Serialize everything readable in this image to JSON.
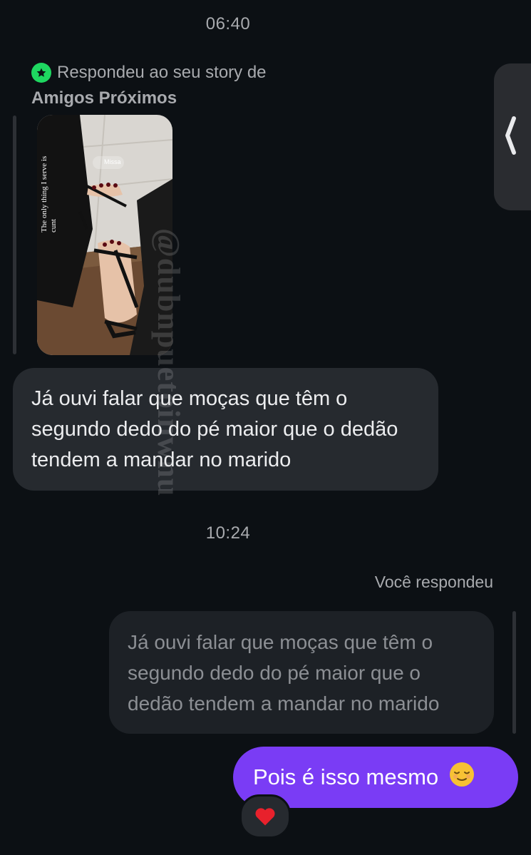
{
  "chat": {
    "timestamp_top": "06:40",
    "story_reply": {
      "header_line1": "Respondeu ao seu story de",
      "header_line2": "Amigos Próximos",
      "image_caption": "The only thing I serve is cunt",
      "location_sticker": "Missa"
    },
    "incoming_message": "Já ouvi falar que moças que têm o segundo dedo do pé maior que o dedão tendem a mandar no marido",
    "timestamp_middle": "10:24",
    "you_replied_label": "Você respondeu",
    "quoted_message": "Já ouvi falar que moças que têm o segundo dedo do pé maior que o dedão tendem a mandar no marido",
    "outgoing_message": "Pois é isso mesmo",
    "outgoing_emoji": "relieved-face",
    "reaction": "heart",
    "watermark": "@dubnpuetoinwnu"
  },
  "colors": {
    "background": "#0c1014",
    "incoming_bubble": "#262a2f",
    "outgoing_bubble": "#7a3cf5",
    "close_friends_green": "#1ed760"
  }
}
